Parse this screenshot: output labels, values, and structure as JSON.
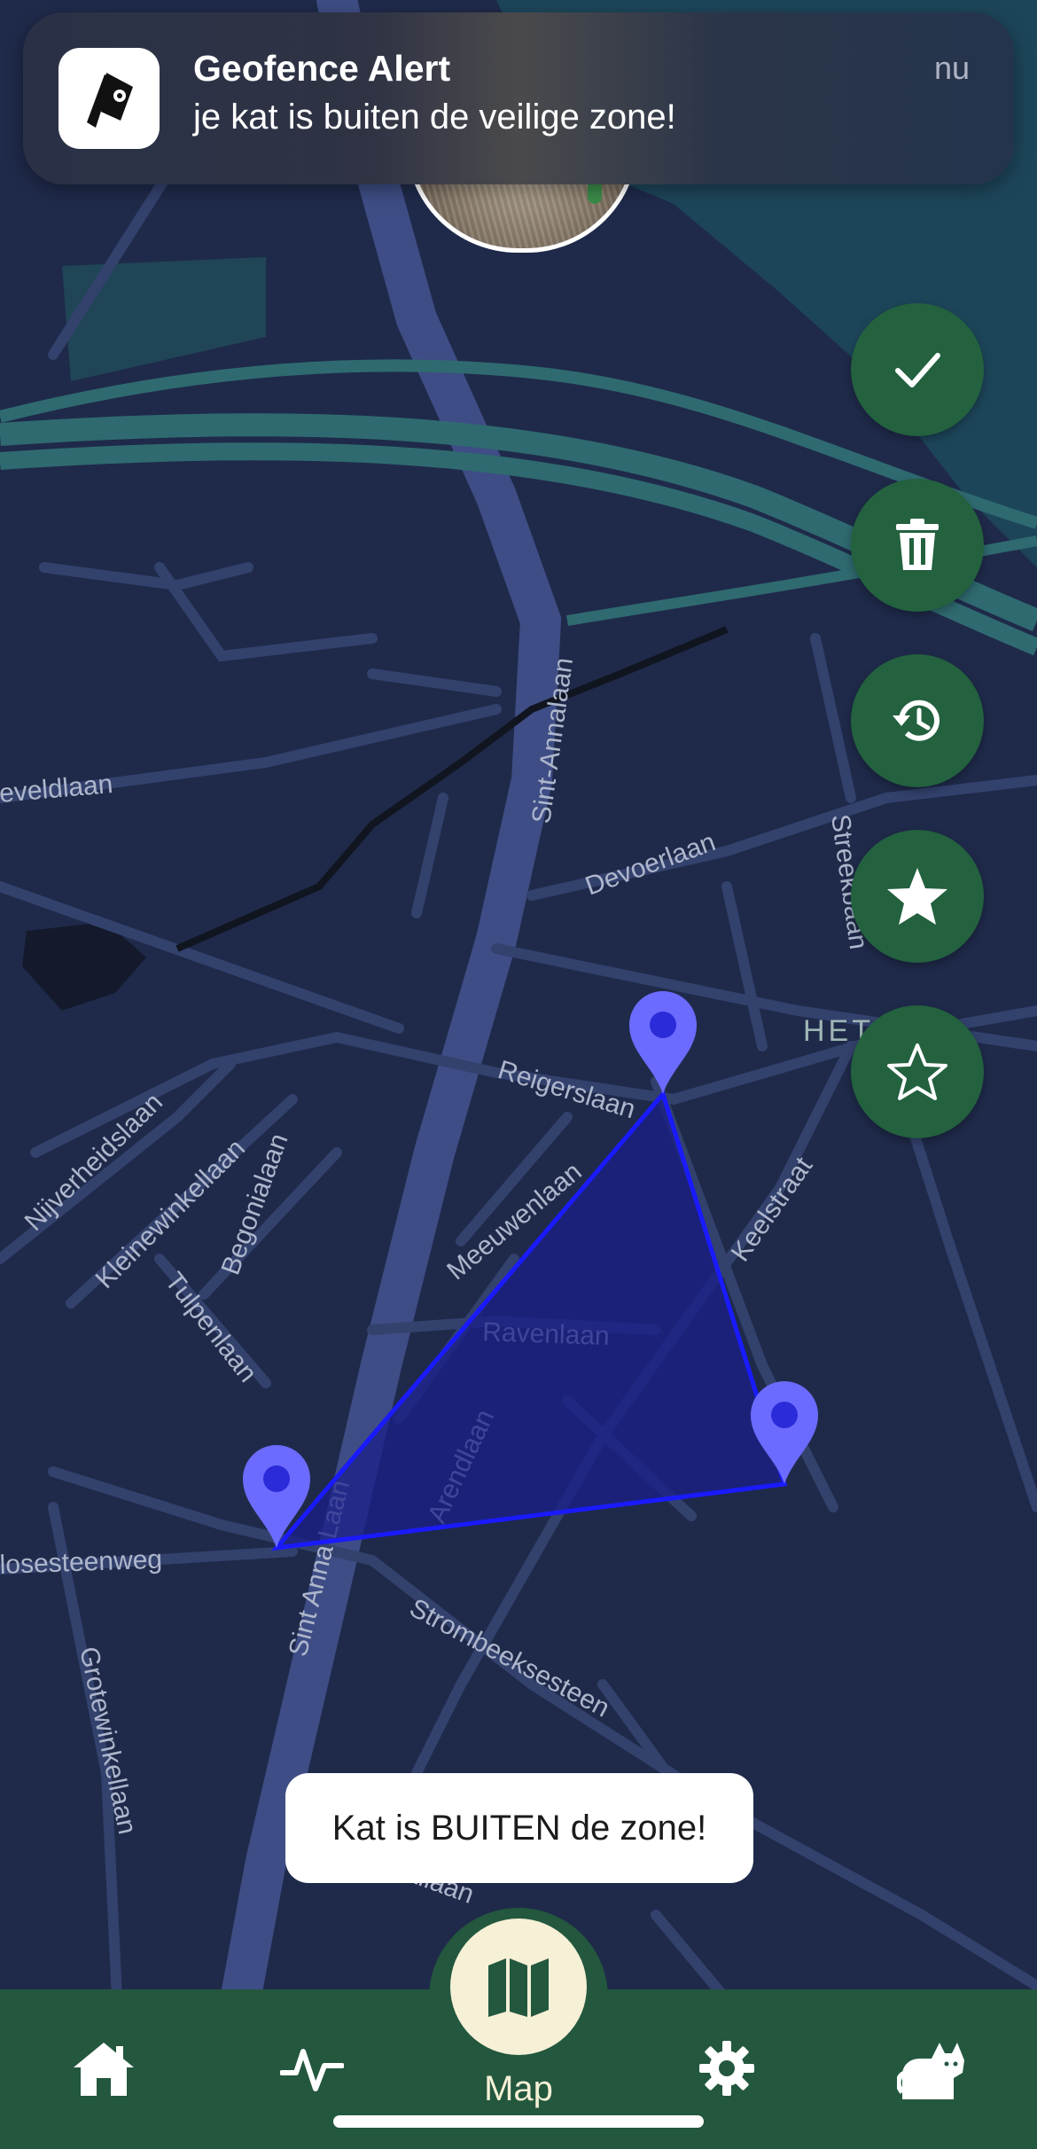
{
  "notification": {
    "title": "Geofence Alert",
    "message": "je kat is buiten de veilige zone!",
    "time": "nu"
  },
  "map": {
    "area_label": "HET    OR",
    "streets": [
      "eveldlaan",
      "Sint-Annalaan",
      "Devoerlaan",
      "Streekbaan",
      "Reigerslaan",
      "Nijverheidslaan",
      "Kleinewinkellaan",
      "Begonialaan",
      "Meeuwenlaan",
      "Keelstraat",
      "Tulpenlaan",
      "Ravenlaan",
      "Arendlaan",
      "Sint Anna Laan",
      "losesteenweg",
      "Strombeeksesteen",
      "Grotewinkellaan",
      "allaan"
    ]
  },
  "actions": [
    {
      "name": "confirm",
      "icon": "check-icon"
    },
    {
      "name": "delete",
      "icon": "trash-icon"
    },
    {
      "name": "history",
      "icon": "history-icon"
    },
    {
      "name": "favorite-filled",
      "icon": "star-filled-icon"
    },
    {
      "name": "favorite-outline",
      "icon": "star-outline-icon"
    }
  ],
  "toast": {
    "text": "Kat is BUITEN de zone!"
  },
  "nav": {
    "items": [
      {
        "icon": "home-icon"
      },
      {
        "icon": "activity-icon"
      },
      {
        "icon": "map-icon",
        "label": "Map",
        "active": true
      },
      {
        "icon": "settings-gear-icon"
      },
      {
        "icon": "cat-icon"
      }
    ]
  },
  "colors": {
    "map_background": "#1f2a4a",
    "fab_green": "#23613f",
    "nav_green": "#23573e",
    "geofence_stroke": "#1a1aff",
    "marker": "#6b6bff"
  }
}
